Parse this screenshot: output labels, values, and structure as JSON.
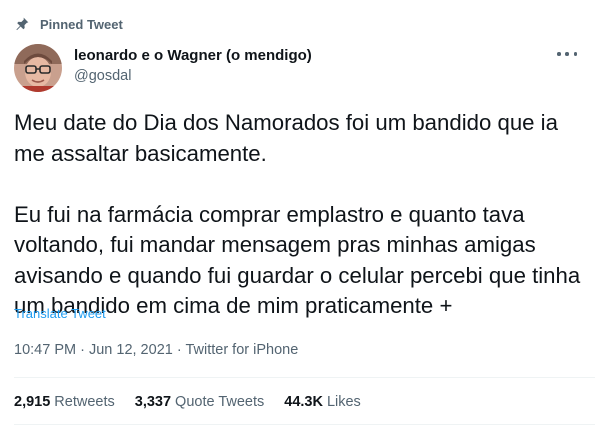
{
  "pinned": {
    "label": "Pinned Tweet",
    "icon": "pin-icon"
  },
  "author": {
    "display_name": "leonardo e o Wagner (o mendigo)",
    "handle": "@gosdal",
    "avatar_icon": "avatar"
  },
  "more_icon": "more-options-icon",
  "tweet": {
    "paragraph_1": "Meu date do Dia dos Namorados foi um bandido que ia me assaltar basicamente.",
    "paragraph_2": "Eu fui na farmácia comprar emplastro e quanto tava voltando, fui mandar mensagem pras minhas amigas avisando e quando fui guardar o celular percebi que tinha um bandido em cima de mim praticamente +"
  },
  "translate_label": "Translate Tweet",
  "meta": {
    "time": "10:47 PM",
    "separator_1": " · ",
    "date": "Jun 12, 2021",
    "separator_2": " · ",
    "source": "Twitter for iPhone"
  },
  "stats": {
    "retweets_count": "2,915",
    "retweets_label": "Retweets",
    "quotes_count": "3,337",
    "quotes_label": "Quote Tweets",
    "likes_count": "44.3K",
    "likes_label": "Likes"
  },
  "colors": {
    "text": "#0f1419",
    "secondary": "#536471",
    "link": "#1d9bf0",
    "divider": "#eff3f4"
  }
}
